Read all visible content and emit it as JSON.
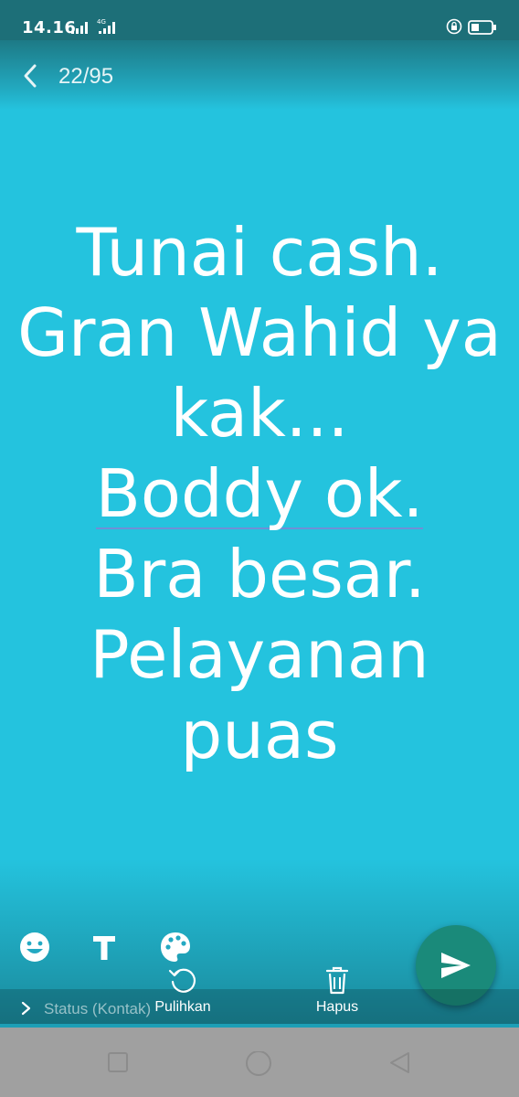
{
  "status_bar": {
    "time": "14.16",
    "network": "4G"
  },
  "viewer": {
    "counter": "22/95"
  },
  "caption": {
    "lines": [
      "Tunai cash.",
      "Gran Wahid ya",
      "kak...",
      "Boddy ok.",
      "Bra besar.",
      "Pelayanan",
      "puas"
    ]
  },
  "tools": {
    "emoji_icon": "smiley-icon",
    "text_icon": "text-icon",
    "palette_icon": "palette-icon"
  },
  "actions": {
    "restore_label": "Pulihkan",
    "delete_label": "Hapus"
  },
  "status_row": {
    "label": "Status (Kontak)"
  },
  "colors": {
    "background": "#24c3de",
    "send_button": "#1a8a7a",
    "top_bar": "#1d6f78",
    "nav_bar": "#a0a0a0"
  }
}
